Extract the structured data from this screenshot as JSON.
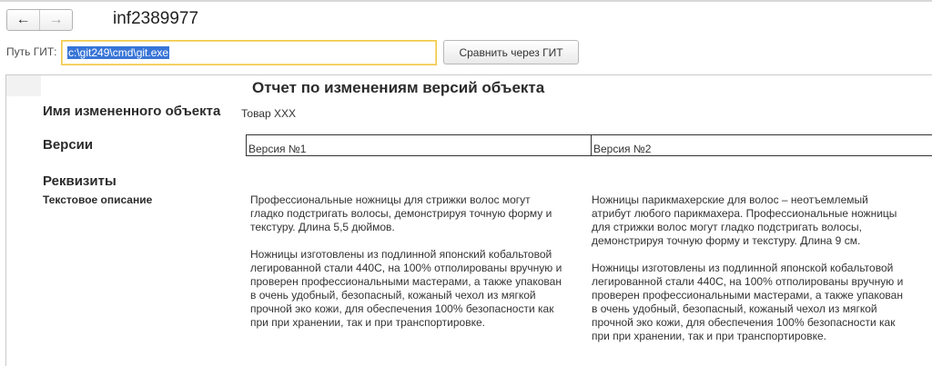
{
  "window": {
    "title": "inf2389977"
  },
  "nav": {
    "back_icon": "←",
    "forward_icon": "→"
  },
  "path": {
    "label": "Путь ГИТ:",
    "value": "c:\\git249\\cmd\\git.exe"
  },
  "toolbar": {
    "compare_label": "Сравнить через ГИТ"
  },
  "report": {
    "title": "Отчет по изменениям версий объекта",
    "object_label": "Имя измененного объекта",
    "object_value": "Товар XXX",
    "versions_label": "Версии",
    "versions": [
      "Версия №1",
      "Версия №2"
    ],
    "attributes_label": "Реквизиты",
    "text_description_label": "Текстовое описание",
    "description_v1": [
      "Профессиональные ножницы для стрижки волос могут",
      "гладко подстригать волосы, демонстрируя точную форму и",
      "текстуру. Длина 5,5 дюймов.",
      "",
      "Ножницы изготовлены из подлинной японский кобальтовой",
      "легированной стали 440С, на 100% отполированы вручную и",
      "проверен профессиональными мастерами, а также упакован",
      "в очень удобный, безопасный, кожаный чехол из мягкой",
      "прочной эко кожи, для обеспечения 100% безопасности как",
      "при при хранении, так и при транспортировке."
    ],
    "description_v2": [
      "Ножницы парикмахерские для волос – неотъемлемый",
      "атрибут любого парикмахера. Профессиональные ножницы",
      "для стрижки волос могут гладко подстригать волосы,",
      "демонстрируя точную форму и текстуру. Длина 9 см.",
      "",
      "Ножницы изготовлены из подлинной японской кобальтовой",
      "легированной стали 440С, на 100% отполированы вручную и",
      "проверен профессиональными мастерами, а также упакован",
      "в очень удобный, безопасный, кожаный чехол из мягкой",
      "прочной эко кожи, для обеспечения 100% безопасности как",
      "при при хранении, так и при транспортировке."
    ]
  }
}
